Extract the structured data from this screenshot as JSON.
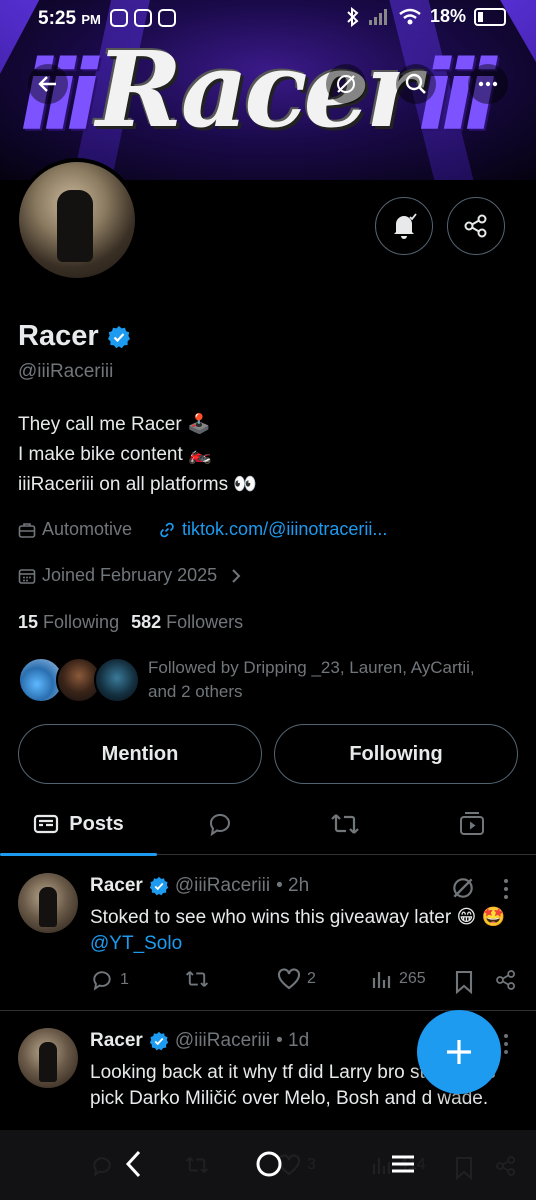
{
  "status_bar": {
    "time": "5:25",
    "ampm": "PM",
    "battery": "18%"
  },
  "banner": {
    "logo_text": "Racer",
    "bars_left": "iii",
    "bars_right": "iii"
  },
  "profile": {
    "name": "Racer",
    "handle": "@iiiRaceriii",
    "bio_lines": [
      "They call me Racer 🕹️",
      "I make bike content 🏍️",
      "iiiRaceriii on all platforms 👀"
    ],
    "category": "Automotive",
    "link": "tiktok.com/@iiinotracerii...",
    "joined": "Joined February 2025",
    "following_count": "15",
    "following_label": "Following",
    "followers_count": "582",
    "followers_label": "Followers",
    "followed_by_line1": "Followed by Dripping _23, Lauren, AyCartii,",
    "followed_by_line2": "and 2 others"
  },
  "buttons": {
    "mention": "Mention",
    "following": "Following"
  },
  "tabs": {
    "posts": "Posts"
  },
  "posts": [
    {
      "name": "Racer",
      "handle": "@iiiRaceriii",
      "time": "• 2h",
      "text": "Stoked to see who wins this giveaway later 😁 🤩 ",
      "mention": "@YT_Solo",
      "replies": "1",
      "likes": "2",
      "views": "265"
    },
    {
      "name": "Racer",
      "handle": "@iiiRaceriii",
      "time": "• 1d",
      "text": "Looking back at it why tf did Larry bro stupid ass pick Darko Miličić over Melo, Bosh and d wade.",
      "replies": "",
      "likes": "3",
      "views": "414"
    }
  ],
  "colors": {
    "accent": "#1d9bf0",
    "muted": "#71767b",
    "text": "#e7e9ea",
    "border": "#2f3336"
  }
}
